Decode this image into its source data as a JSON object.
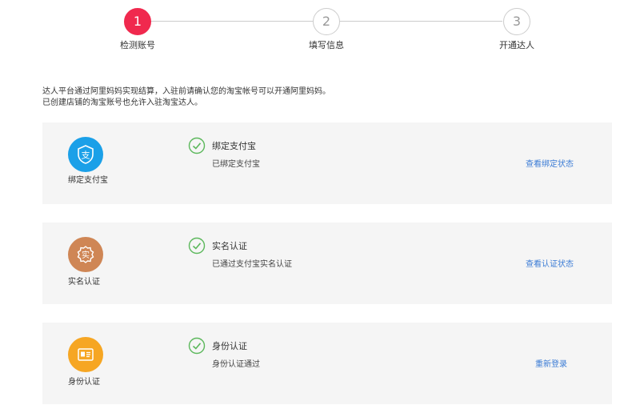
{
  "steps": [
    {
      "number": "1",
      "label": "检测账号",
      "state": "active"
    },
    {
      "number": "2",
      "label": "填写信息",
      "state": "inactive"
    },
    {
      "number": "3",
      "label": "开通达人",
      "state": "inactive"
    }
  ],
  "intro": {
    "line1": "达人平台通过阿里妈妈实现结算，入驻前请确认您的淘宝帐号可以开通阿里妈妈。",
    "line2": "已创建店铺的淘宝账号也允许入驻淘宝达人。"
  },
  "cards": [
    {
      "icon": "alipay-icon",
      "icon_color": "#1ba0e8",
      "icon_label": "绑定支付宝",
      "status_icon": "check-circle-icon",
      "title": "绑定支付宝",
      "desc": "已绑定支付宝",
      "link": "查看绑定状态"
    },
    {
      "icon": "real-name-icon",
      "icon_color": "#cf8655",
      "icon_label": "实名认证",
      "status_icon": "check-circle-icon",
      "title": "实名认证",
      "desc": "已通过支付宝实名认证",
      "link": "查看认证状态"
    },
    {
      "icon": "id-card-icon",
      "icon_color": "#f6a623",
      "icon_label": "身份认证",
      "status_icon": "check-circle-icon",
      "title": "身份认证",
      "desc": "身份认证通过",
      "link": "重新登录"
    }
  ],
  "colors": {
    "active_step": "#f0294e",
    "check_green": "#5cb85c",
    "link_blue": "#3a7bd5"
  }
}
